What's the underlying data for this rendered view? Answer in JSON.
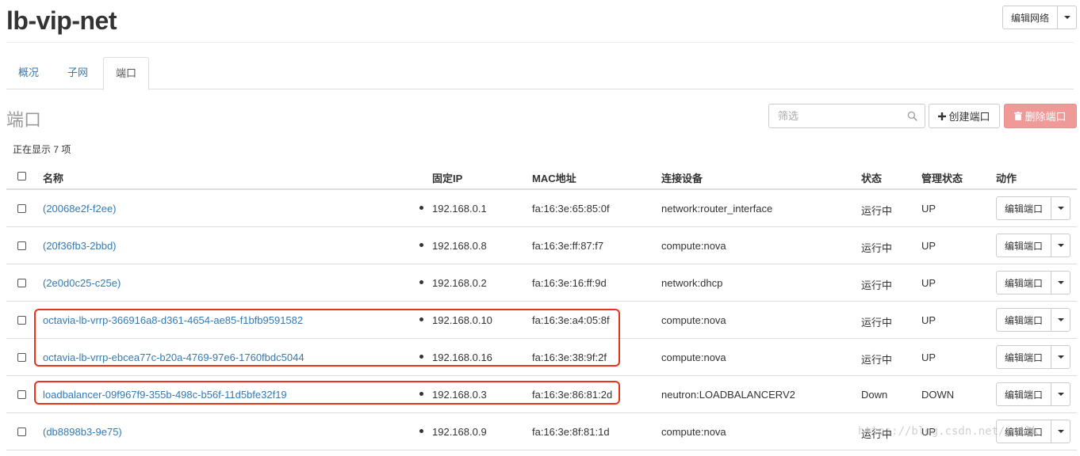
{
  "page": {
    "title": "lb-vip-net",
    "edit_network_label": "编辑网络"
  },
  "tabs": [
    {
      "label": "概况"
    },
    {
      "label": "子网"
    },
    {
      "label": "端口"
    }
  ],
  "section": {
    "title": "端口",
    "filter_placeholder": "筛选",
    "create_label": "创建端口",
    "delete_label": "删除端口",
    "count_text": "正在显示 7 项"
  },
  "table": {
    "headers": [
      "名称",
      "固定IP",
      "MAC地址",
      "连接设备",
      "状态",
      "管理状态",
      "动作"
    ],
    "rows": [
      {
        "name": "(20068e2f-f2ee)",
        "ip": "192.168.0.1",
        "mac": "fa:16:3e:65:85:0f",
        "device": "network:router_interface",
        "status": "运行中",
        "admin": "UP",
        "action": "编辑端口"
      },
      {
        "name": "(20f36fb3-2bbd)",
        "ip": "192.168.0.8",
        "mac": "fa:16:3e:ff:87:f7",
        "device": "compute:nova",
        "status": "运行中",
        "admin": "UP",
        "action": "编辑端口"
      },
      {
        "name": "(2e0d0c25-c25e)",
        "ip": "192.168.0.2",
        "mac": "fa:16:3e:16:ff:9d",
        "device": "network:dhcp",
        "status": "运行中",
        "admin": "UP",
        "action": "编辑端口"
      },
      {
        "name": "octavia-lb-vrrp-366916a8-d361-4654-ae85-f1bfb9591582",
        "ip": "192.168.0.10",
        "mac": "fa:16:3e:a4:05:8f",
        "device": "compute:nova",
        "status": "运行中",
        "admin": "UP",
        "action": "编辑端口"
      },
      {
        "name": "octavia-lb-vrrp-ebcea77c-b20a-4769-97e6-1760fbdc5044",
        "ip": "192.168.0.16",
        "mac": "fa:16:3e:38:9f:2f",
        "device": "compute:nova",
        "status": "运行中",
        "admin": "UP",
        "action": "编辑端口"
      },
      {
        "name": "loadbalancer-09f967f9-355b-498c-b56f-11d5bfe32f19",
        "ip": "192.168.0.3",
        "mac": "fa:16:3e:86:81:2d",
        "device": "neutron:LOADBALANCERV2",
        "status": "Down",
        "admin": "DOWN",
        "action": "编辑端口"
      },
      {
        "name": "(db8898b3-9e75)",
        "ip": "192.168.0.9",
        "mac": "fa:16:3e:8f:81:1d",
        "device": "compute:nova",
        "status": "运行中",
        "admin": "UP",
        "action": "编辑端口"
      }
    ]
  },
  "watermark": "https://blog.csdn.net/jmilk",
  "colors": {
    "link": "#337ab7",
    "danger": "#ef9a98",
    "highlight": "#e8331c"
  }
}
